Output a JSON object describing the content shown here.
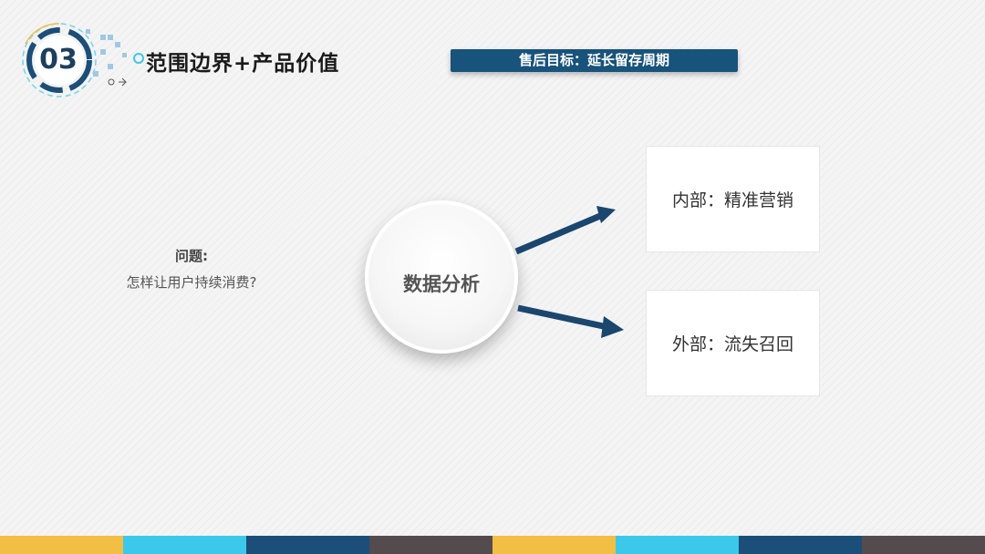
{
  "header": {
    "section_number": "03",
    "section_title": "范围边界+产品价值",
    "target_banner": "售后目标：延长留存周期"
  },
  "question": {
    "label": "问题:",
    "text": "怎样让用户持续消费?"
  },
  "center": {
    "label": "数据分析"
  },
  "outcomes": {
    "internal": "内部：精准营销",
    "external": "外部：流失召回"
  },
  "colors": {
    "banner": "#18537b",
    "arrow": "#1b466d",
    "footer": [
      "#f2be44",
      "#3cc8ea",
      "#1b4e78",
      "#534b4e",
      "#f2be44",
      "#3cc8ea",
      "#1b4e78",
      "#534b4e"
    ]
  }
}
